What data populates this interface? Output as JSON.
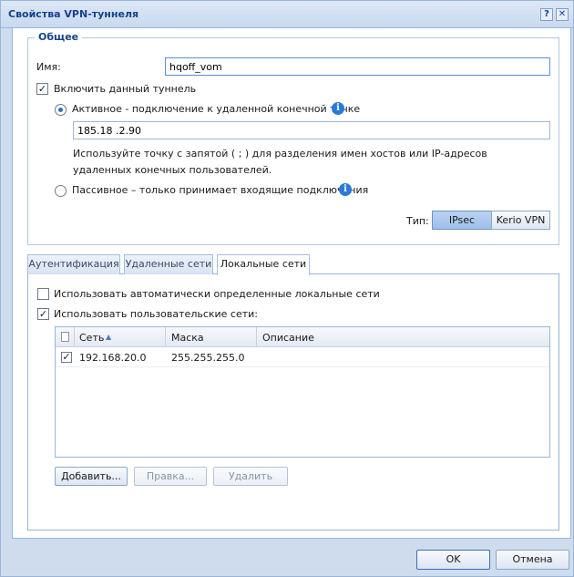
{
  "window": {
    "title": "Свойства VPN-туннеля"
  },
  "title_buttons": {
    "help": "?",
    "close": "✕"
  },
  "general": {
    "legend": "Общее",
    "name_label": "Имя:",
    "name_value": "hqoff_vom",
    "enable_label": "Включить данный туннель",
    "enable_checked": true,
    "active_label": "Активное - подключение к удаленной конечной точке",
    "host_value": "185.18 .2.90",
    "host_hint": "Используйте точку с запятой ( ; ) для разделения имен хостов или IP-адресов удаленных конечных пользователей.",
    "passive_label": "Пассивное – только принимает входящие подключения",
    "type_label": "Тип:",
    "type_options": [
      "IPsec",
      "Kerio VPN"
    ],
    "type_selected": "IPsec"
  },
  "tabs": [
    {
      "label": "Аутентификация"
    },
    {
      "label": "Удаленные сети"
    },
    {
      "label": "Локальные сети"
    }
  ],
  "local": {
    "auto_label": "Использовать автоматически определенные локальные сети",
    "custom_label": "Использовать пользовательские сети:",
    "columns": {
      "net": "Сеть",
      "mask": "Маска",
      "description": "Описание"
    },
    "rows": [
      {
        "net": "192.168.20.0",
        "mask": "255.255.255.0",
        "description": ""
      }
    ],
    "buttons": {
      "add": "Добавить...",
      "edit": "Правка...",
      "delete": "Удалить"
    }
  },
  "footer": {
    "ok": "OK",
    "cancel": "Отмена"
  },
  "icons": {
    "info": "info-icon",
    "sort": "sort-ascending-icon",
    "check": "checkmark-icon"
  }
}
